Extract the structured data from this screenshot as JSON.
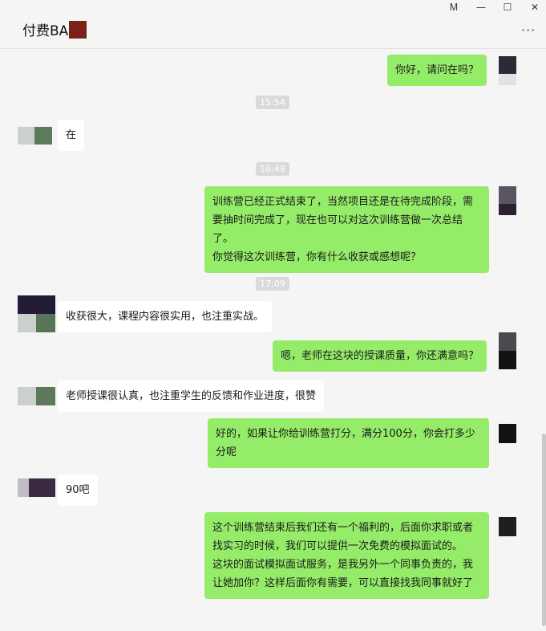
{
  "window": {
    "title": "付费BA",
    "pin_icon": "pin-icon",
    "pin_glyph": "Ꮇ",
    "minimize_glyph": "—",
    "maximize_glyph": "☐",
    "close_glyph": "✕",
    "more_glyph": "···"
  },
  "messages": [
    {
      "kind": "me",
      "text": "你好，请问在吗？"
    },
    {
      "kind": "time",
      "text": "15:54"
    },
    {
      "kind": "them",
      "text": "在"
    },
    {
      "kind": "time",
      "text": "16:49"
    },
    {
      "kind": "me",
      "text": "训练营已经正式结束了，当然项目还是在待完成阶段，需要抽时间完成了，现在也可以对这次训练营做一次总结了。\n你觉得这次训练营，你有什么收获或感想呢？"
    },
    {
      "kind": "time",
      "text": "17:09"
    },
    {
      "kind": "them",
      "text": "收获很大，课程内容很实用，也注重实战。"
    },
    {
      "kind": "me",
      "text": "嗯，老师在这块的授课质量，你还满意吗？"
    },
    {
      "kind": "them",
      "text": "老师授课很认真，也注重学生的反馈和作业进度，很赞"
    },
    {
      "kind": "me",
      "text": "好的，如果让你给训练营打分，满分100分，你会打多少分呢"
    },
    {
      "kind": "them",
      "text": "90吧"
    },
    {
      "kind": "me",
      "text": "这个训练营结束后我们还有一个福利的，后面你求职或者找实习的时候，我们可以提供一次免费的模拟面试的。\n这块的面试模拟面试服务，是我另外一个同事负责的，我让她加你？这样后面你有需要，可以直接找我同事就好了"
    }
  ]
}
